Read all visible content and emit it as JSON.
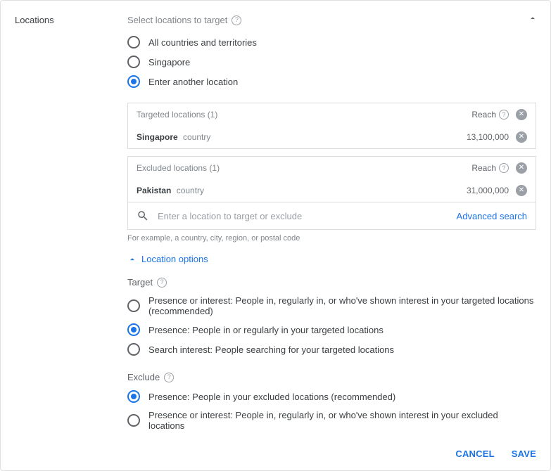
{
  "section": {
    "title": "Locations",
    "subheader": "Select locations to target"
  },
  "location_radios": {
    "all": "All countries and territories",
    "singapore": "Singapore",
    "another": "Enter another location"
  },
  "targeted_box": {
    "header": "Targeted locations (1)",
    "reach_label": "Reach",
    "rows": [
      {
        "name": "Singapore",
        "type": "country",
        "reach": "13,100,000"
      }
    ]
  },
  "excluded_box": {
    "header": "Excluded locations (1)",
    "reach_label": "Reach",
    "rows": [
      {
        "name": "Pakistan",
        "type": "country",
        "reach": "31,000,000"
      }
    ]
  },
  "search": {
    "placeholder": "Enter a location to target or exclude",
    "advanced": "Advanced search",
    "hint": "For example, a country, city, region, or postal code"
  },
  "location_options_label": "Location options",
  "target_section": {
    "title": "Target",
    "opt1": "Presence or interest: People in, regularly in, or who've shown interest in your targeted locations (recommended)",
    "opt2": "Presence: People in or regularly in your targeted locations",
    "opt3": "Search interest: People searching for your targeted locations"
  },
  "exclude_section": {
    "title": "Exclude",
    "opt1": "Presence: People in your excluded locations (recommended)",
    "opt2": "Presence or interest: People in, regularly in, or who've shown interest in your excluded locations"
  },
  "footer": {
    "cancel": "CANCEL",
    "save": "SAVE"
  }
}
